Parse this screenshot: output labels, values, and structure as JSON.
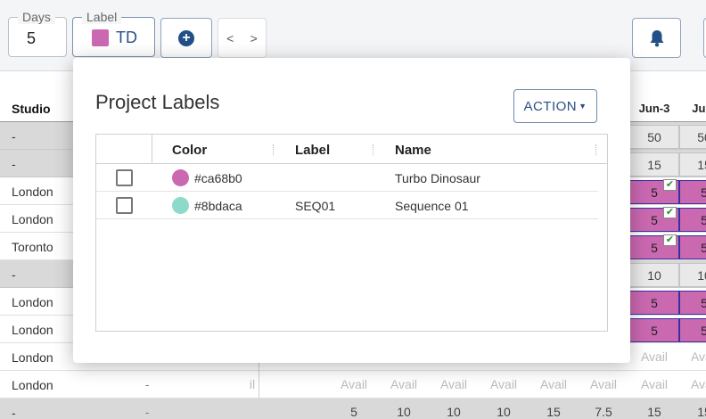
{
  "toolbar": {
    "days_legend": "Days",
    "days_value": "5",
    "label_legend": "Label",
    "label_value": "TD",
    "label_color": "#ca68b0",
    "add_icon": "plus-circle-icon",
    "prev": "<",
    "next": ">",
    "bell_icon": "bell-icon"
  },
  "grid": {
    "header": {
      "studio": "Studio",
      "dates": [
        "Jun-3",
        "Jun-"
      ]
    },
    "rows": [
      {
        "studio": "-",
        "type": "gray",
        "col1": "50",
        "col2": "50"
      },
      {
        "studio": "-",
        "type": "gray",
        "col1": "15",
        "col2": "15"
      },
      {
        "studio": "London",
        "type": "pink",
        "col1": "5",
        "col2": "5",
        "check": "✔"
      },
      {
        "studio": "London",
        "type": "pink",
        "col1": "5",
        "col2": "5",
        "check": "✔"
      },
      {
        "studio": "Toronto",
        "type": "pink",
        "col1": "5",
        "col2": "5",
        "check": "✔"
      },
      {
        "studio": "-",
        "type": "gray",
        "col1": "10",
        "col2": "10"
      },
      {
        "studio": "London",
        "type": "pink",
        "col1": "5",
        "col2": "5"
      },
      {
        "studio": "London",
        "type": "pink",
        "col1": "5",
        "col2": "5"
      },
      {
        "studio": "London",
        "type": "avail",
        "cells": [
          "Avail",
          "Avail",
          "Avail",
          "Avail",
          "Avail",
          "Avail",
          "Avail",
          "Avail",
          "Avail"
        ]
      },
      {
        "studio": "London",
        "dash": "-",
        "type": "avail",
        "cells": [
          "il",
          "Avail",
          "Avail",
          "Avail",
          "Avail",
          "Avail",
          "Avail",
          "Avail",
          "Avail"
        ]
      },
      {
        "studio": "-",
        "dash": "-",
        "type": "gray",
        "cells": [
          "5",
          "10",
          "10",
          "10",
          "15",
          "7.5",
          "15",
          "15"
        ]
      }
    ]
  },
  "modal": {
    "title": "Project Labels",
    "action_label": "ACTION",
    "columns": {
      "color": "Color",
      "label": "Label",
      "name": "Name"
    },
    "rows": [
      {
        "color": "#ca68b0",
        "label": "",
        "name": "Turbo Dinosaur"
      },
      {
        "color": "#8bdaca",
        "label": "SEQ01",
        "name": "Sequence 01"
      }
    ]
  }
}
